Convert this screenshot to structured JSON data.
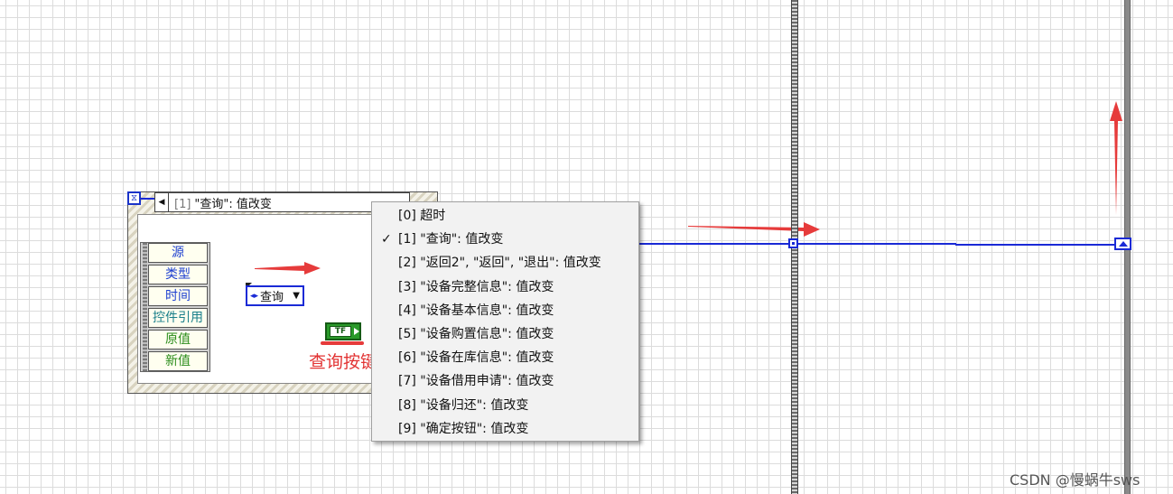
{
  "event_structure": {
    "case_selector": {
      "index": "[1]",
      "label": "\"查询\": 值改变"
    },
    "event_data": [
      "源",
      "类型",
      "时间",
      "控件引用",
      "原值",
      "新值"
    ]
  },
  "enum_control": {
    "value": "查询"
  },
  "boolean_constant": {
    "text": "TF"
  },
  "annotation": {
    "label": "查询按键"
  },
  "context_menu": {
    "selected_index": 1,
    "items": [
      "[0] 超时",
      "[1] \"查询\": 值改变",
      "[2] \"返回2\", \"返回\", \"退出\": 值改变",
      "[3] \"设备完整信息\": 值改变",
      "[4] \"设备基本信息\": 值改变",
      "[5] \"设备购置信息\": 值改变",
      "[6] \"设备在库信息\": 值改变",
      "[7] \"设备借用申请\": 值改变",
      "[8] \"设备归还\": 值改变",
      "[9] \"确定按钮\": 值改变"
    ]
  },
  "check_glyph": "✓",
  "watermark": "CSDN @慢蜗牛sws",
  "colors": {
    "wire": "#1a2ad6",
    "annotation": "#e23333",
    "tf": "#2a9a2a"
  }
}
